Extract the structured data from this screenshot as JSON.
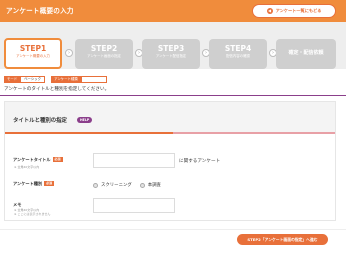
{
  "header": {
    "title": "アンケート概要の入力",
    "back_button_label": "アンケート一覧にもどる"
  },
  "steps": [
    {
      "title": "STEP1",
      "subtitle": "アンケート概要の入力",
      "state": "active"
    },
    {
      "title": "STEP2",
      "subtitle": "アンケート画面の指定",
      "state": "inactive"
    },
    {
      "title": "STEP3",
      "subtitle": "アンケート配信指定",
      "state": "inactive"
    },
    {
      "title": "STEP4",
      "subtitle": "配信内容の確認",
      "state": "inactive"
    },
    {
      "title": "確定・配信依頼",
      "subtitle": "",
      "state": "inactive"
    }
  ],
  "mode_tabs": {
    "mode_label": "モード",
    "mode_value": "ベーシック",
    "survey_type_label": "アンケート種類",
    "survey_type_value": ""
  },
  "instruction": "アンケートのタイトルと種別を指定してください。",
  "section": {
    "title": "タイトルと種別の指定",
    "help_badge": "HELP"
  },
  "form": {
    "title_field": {
      "label": "アンケートタイトル",
      "required_badge": "必須",
      "note": "※ 全角40文字以内",
      "value": "",
      "suffix": "に関するアンケート"
    },
    "type_field": {
      "label": "アンケート種別",
      "required_badge": "必須",
      "options": [
        "スクリーニング",
        "本調査"
      ],
      "selected": null
    },
    "memo_field": {
      "label": "メモ",
      "note_line1": "※ 全角40文字以内",
      "note_line2": "※ ここには表示されません",
      "value": ""
    }
  },
  "next_button_label": "STEP2「アンケート画面の指定」へ進む",
  "colors": {
    "brand_orange": "#f08c3c",
    "accent_orange": "#e8703a",
    "purple": "#8b3f8b",
    "inactive_step": "#cfcfcf"
  }
}
